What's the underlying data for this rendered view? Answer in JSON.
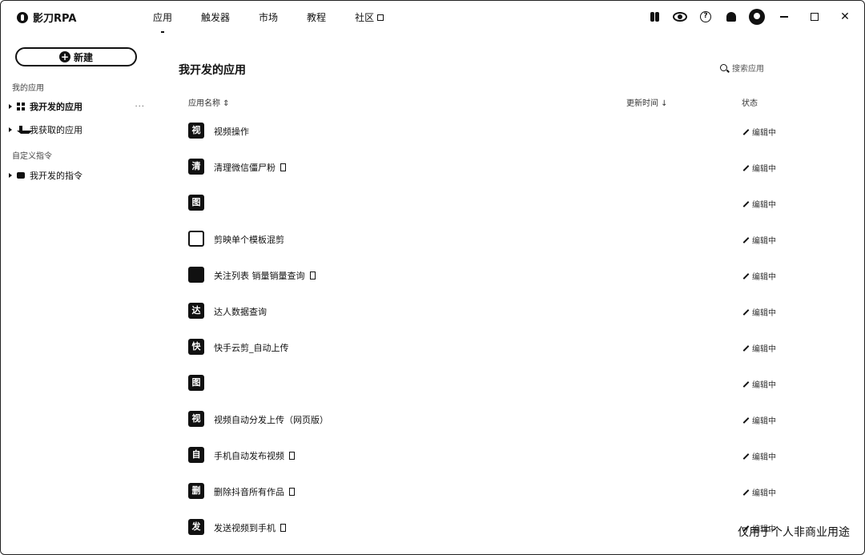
{
  "app": {
    "title": "影刀RPA"
  },
  "nav": {
    "items": [
      {
        "label": "应用",
        "active": true
      },
      {
        "label": "触发器",
        "active": false
      },
      {
        "label": "市场",
        "active": false
      },
      {
        "label": "教程",
        "active": false
      },
      {
        "label": "社区",
        "active": false,
        "external": true
      }
    ]
  },
  "sidebar": {
    "new_button": "新建",
    "group_apps": "我的应用",
    "items_apps": [
      {
        "label": "我开发的应用",
        "icon": "grid-icon",
        "more": "···"
      },
      {
        "label": "我获取的应用",
        "icon": "download-icon"
      }
    ],
    "group_cmds": "自定义指令",
    "items_cmds": [
      {
        "label": "我开发的指令",
        "icon": "cube-icon"
      }
    ]
  },
  "main": {
    "title": "我开发的应用",
    "search_placeholder": "搜索应用",
    "col_name": "应用名称 ⇕",
    "col_updated": "更新时间 ↓",
    "col_status": "状态",
    "edit_label": "编辑中",
    "rows": [
      {
        "icon": "视",
        "name": "视频操作",
        "tag": false
      },
      {
        "icon": "清",
        "name": "清理微信僵尸粉",
        "tag": true
      },
      {
        "icon": "图",
        "name": "",
        "tag": false
      },
      {
        "icon": "",
        "name": "剪映单个模板混剪",
        "tag": false,
        "outline": true
      },
      {
        "icon": "",
        "name": "关注列表 销量销量查询",
        "tag": true
      },
      {
        "icon": "达",
        "name": "达人数据查询",
        "tag": false
      },
      {
        "icon": "快",
        "name": "快手云剪_自动上传",
        "tag": false
      },
      {
        "icon": "图",
        "name": "",
        "tag": false
      },
      {
        "icon": "视",
        "name": "视频自动分发上传（网页版）",
        "tag": false
      },
      {
        "icon": "自",
        "name": "手机自动发布视频",
        "tag": true
      },
      {
        "icon": "删",
        "name": "删除抖音所有作品",
        "tag": true
      },
      {
        "icon": "发",
        "name": "发送视频到手机",
        "tag": true
      }
    ]
  },
  "watermark": "仅用于个人非商业用途"
}
